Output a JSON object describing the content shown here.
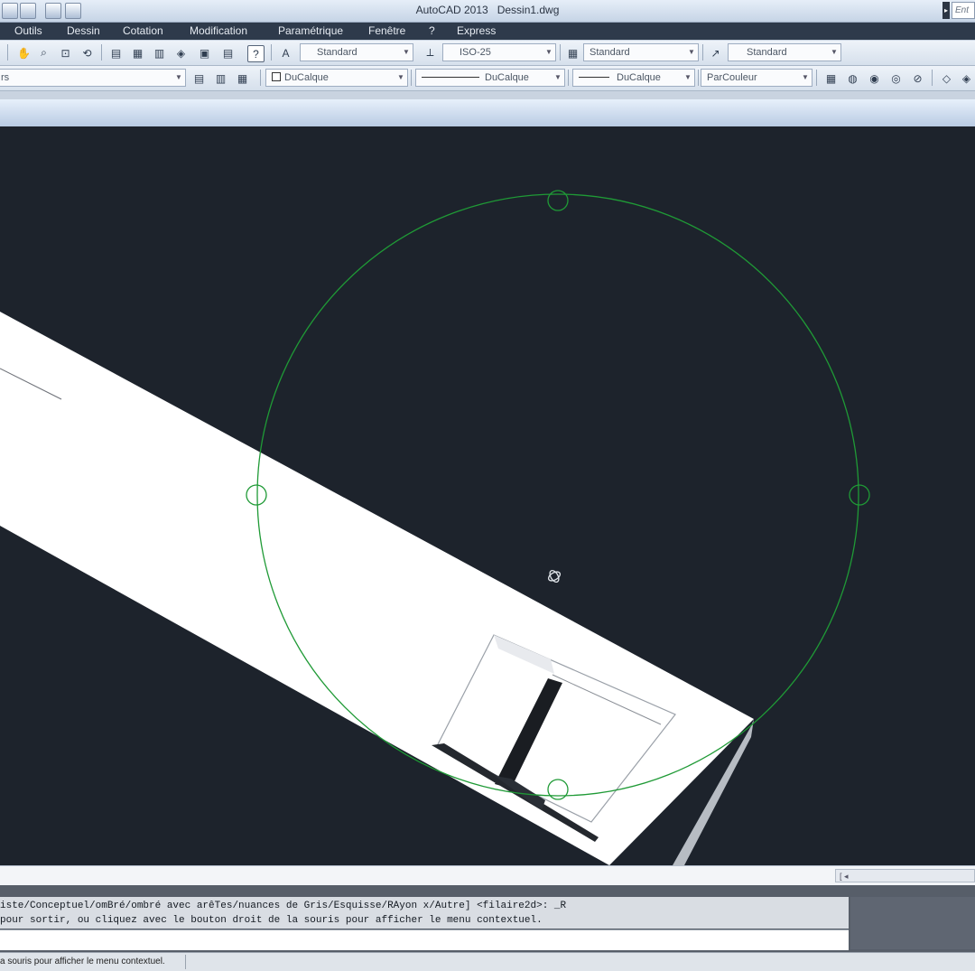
{
  "window": {
    "app_name": "AutoCAD 2013",
    "file_name": "Dessin1.dwg",
    "search_placeholder": "Ent"
  },
  "menu": {
    "items": [
      "Outils",
      "Dessin",
      "Cotation",
      "Modification",
      "Paramétrique",
      "Fenêtre",
      "?",
      "Express"
    ]
  },
  "styles_toolbar": {
    "text_style": "Standard",
    "dim_style": "ISO-25",
    "table_style": "Standard",
    "multileader_style": "Standard"
  },
  "properties_toolbar": {
    "layer_value": "rs",
    "color": "DuCalque",
    "linetype": "DuCalque",
    "lineweight": "DuCalque",
    "plot_style": "ParCouleur"
  },
  "viewport": {
    "background": "#1d232c",
    "orbit_circle_color": "#1f9a36",
    "geometry_color": "#ffffff"
  },
  "command": {
    "line1": "iste/Conceptuel/omBré/ombré avec arêTes/nuances de Gris/Esquisse/RAyon x/Autre] <filaire2d>: _R",
    "line2": " pour sortir, ou cliquez avec le bouton droit de la souris pour afficher le menu contextuel."
  },
  "status_bar": {
    "text": "a souris pour afficher le menu contextuel."
  },
  "scrollbar": {
    "label": "[ ◂"
  }
}
